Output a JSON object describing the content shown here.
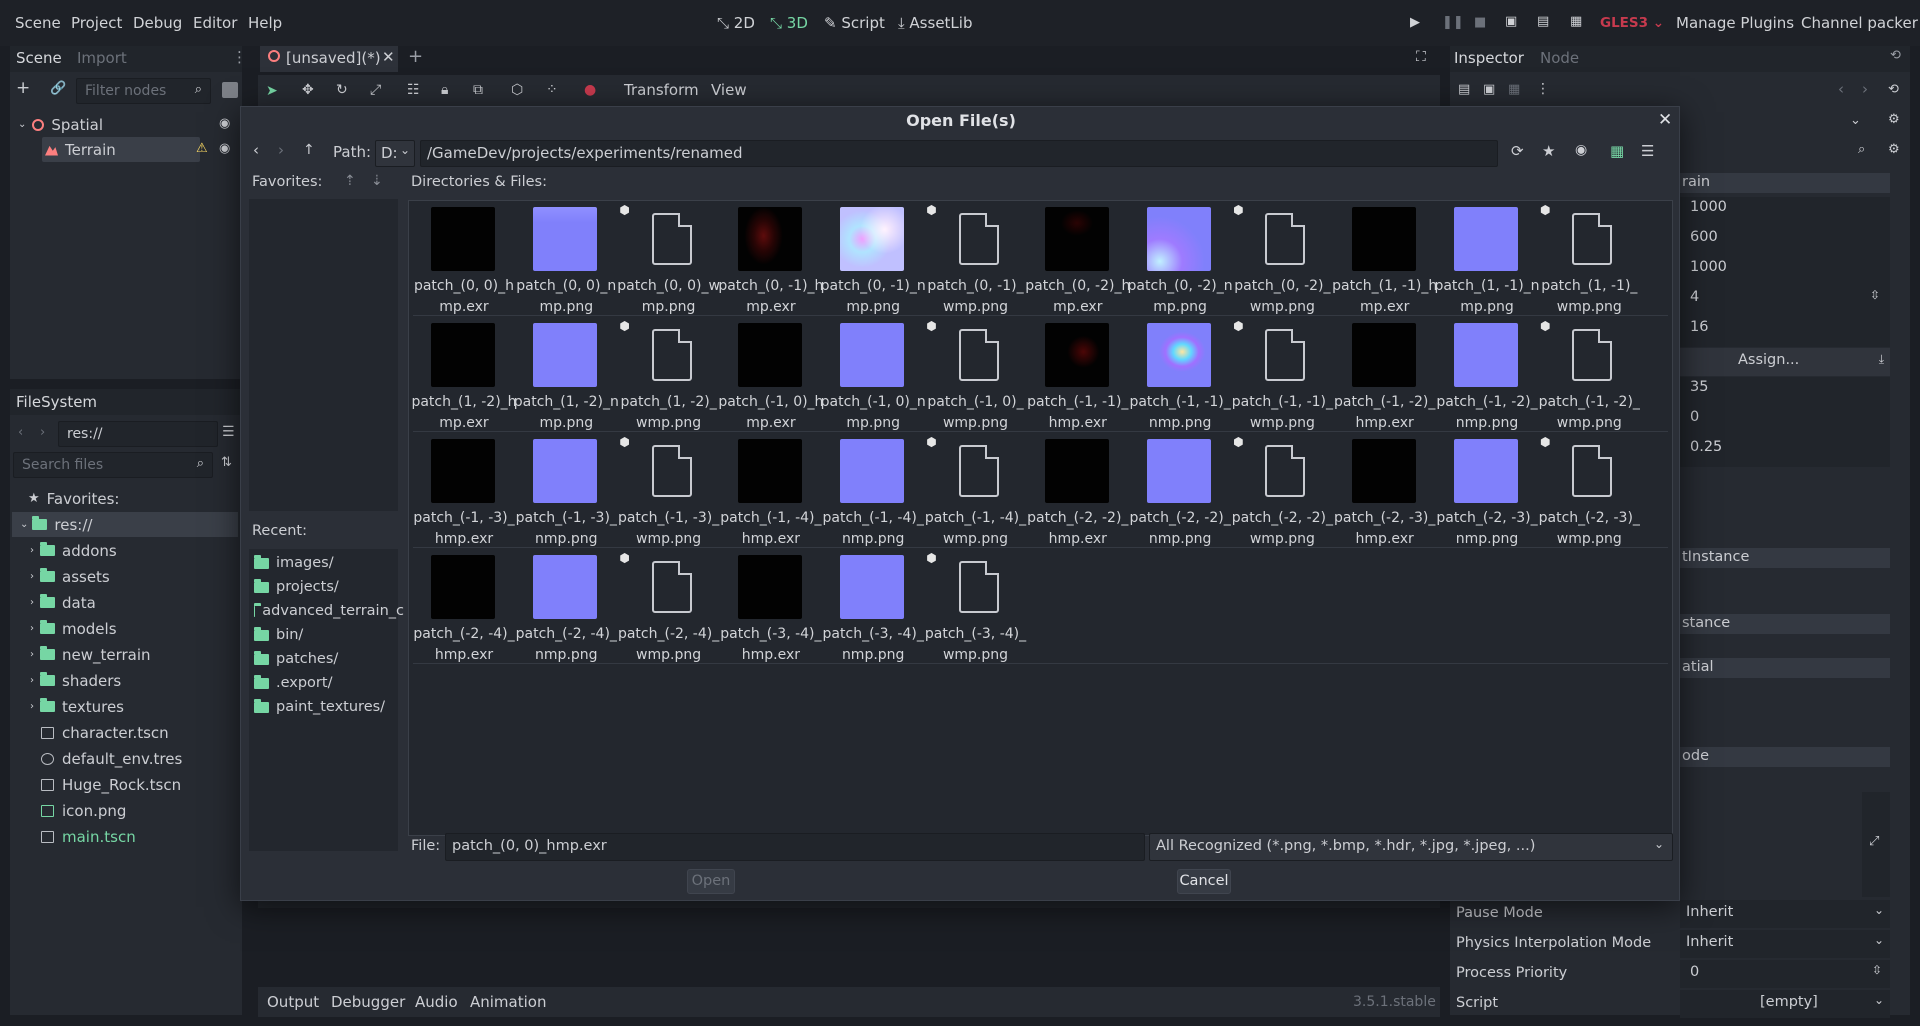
{
  "menubar": {
    "items": [
      "Scene",
      "Project",
      "Debug",
      "Editor",
      "Help"
    ],
    "workspaces": [
      "2D",
      "3D",
      "Script",
      "AssetLib"
    ],
    "renderer": "GLES3",
    "manage_plugins": "Manage Plugins",
    "channel_packer": "Channel packer"
  },
  "scene_dock": {
    "tabs": [
      "Scene",
      "Import"
    ],
    "filter_placeholder": "Filter nodes",
    "nodes": [
      {
        "name": "Spatial"
      },
      {
        "name": "Terrain"
      }
    ]
  },
  "filesystem_dock": {
    "title": "FileSystem",
    "path": "res://",
    "search_placeholder": "Search files",
    "favorites": "Favorites:",
    "root": "res://",
    "folders": [
      "addons",
      "assets",
      "data",
      "models",
      "new_terrain",
      "shaders",
      "textures"
    ],
    "files": [
      "character.tscn",
      "default_env.tres",
      "Huge_Rock.tscn",
      "icon.png",
      "main.tscn"
    ]
  },
  "editor_tab": {
    "title": "[unsaved](*)",
    "toolbar": [
      "Transform",
      "View"
    ]
  },
  "inspector": {
    "tabs": [
      "Inspector",
      "Node"
    ],
    "values": [
      "1000",
      "600",
      "1000",
      "4",
      "16",
      "Assign...",
      "35",
      "0",
      "0.25"
    ],
    "section_fragments": [
      "rain",
      "tInstance",
      "stance",
      "atial",
      "ode"
    ],
    "bottom_props": [
      {
        "label": "Pause Mode",
        "value": "Inherit"
      },
      {
        "label": "Physics Interpolation Mode",
        "value": "Inherit"
      },
      {
        "label": "Process Priority",
        "value": "0"
      },
      {
        "label": "Script",
        "value": "[empty]"
      }
    ]
  },
  "bottom_panel": {
    "tabs": [
      "Output",
      "Debugger",
      "Audio",
      "Animation"
    ],
    "version": "3.5.1.stable"
  },
  "dialog": {
    "title": "Open File(s)",
    "path_label": "Path:",
    "drive": "D:",
    "path": "/GameDev/projects/experiments/renamed",
    "favorites_label": "Favorites:",
    "dirs_label": "Directories & Files:",
    "recent_label": "Recent:",
    "recent": [
      "images/",
      "projects/",
      "advanced_terrain_c",
      "bin/",
      "patches/",
      ".export/",
      "paint_textures/"
    ],
    "file_label": "File:",
    "file_value": "patch_(0, 0)_hmp.exr",
    "filter": "All Recognized (*.png, *.bmp, *.hdr, *.jpg, *.jpeg, ...)",
    "open": "Open",
    "cancel": "Cancel",
    "files": [
      {
        "line1": "patch_(0, 0)_h",
        "line2": "mp.exr",
        "kind": "exr",
        "thumb": "exr"
      },
      {
        "line1": "patch_(0, 0)_n",
        "line2": "mp.png",
        "kind": "png",
        "thumb": "n0"
      },
      {
        "line1": "patch_(0, 0)_w",
        "line2": "mp.png",
        "kind": "doc",
        "thumb": "doc"
      },
      {
        "line1": "patch_(0, -1)_h",
        "line2": "mp.exr",
        "kind": "exr",
        "thumb": "r1"
      },
      {
        "line1": "patch_(0, -1)_n",
        "line2": "mp.png",
        "kind": "png",
        "thumb": "n1"
      },
      {
        "line1": "patch_(0, -1)_",
        "line2": "wmp.png",
        "kind": "doc",
        "thumb": "doc"
      },
      {
        "line1": "patch_(0, -2)_h",
        "line2": "mp.exr",
        "kind": "exr",
        "thumb": "r2"
      },
      {
        "line1": "patch_(0, -2)_n",
        "line2": "mp.png",
        "kind": "png",
        "thumb": "n2"
      },
      {
        "line1": "patch_(0, -2)_",
        "line2": "wmp.png",
        "kind": "doc",
        "thumb": "doc"
      },
      {
        "line1": "patch_(1, -1)_h",
        "line2": "mp.exr",
        "kind": "exr",
        "thumb": "exr"
      },
      {
        "line1": "patch_(1, -1)_n",
        "line2": "mp.png",
        "kind": "png",
        "thumb": "png"
      },
      {
        "line1": "patch_(1, -1)_",
        "line2": "wmp.png",
        "kind": "doc",
        "thumb": "doc"
      },
      {
        "line1": "patch_(1, -2)_h",
        "line2": "mp.exr",
        "kind": "exr",
        "thumb": "exr"
      },
      {
        "line1": "patch_(1, -2)_n",
        "line2": "mp.png",
        "kind": "png",
        "thumb": "png"
      },
      {
        "line1": "patch_(1, -2)_",
        "line2": "wmp.png",
        "kind": "doc",
        "thumb": "doc"
      },
      {
        "line1": "patch_(-1, 0)_h",
        "line2": "mp.exr",
        "kind": "exr",
        "thumb": "exr"
      },
      {
        "line1": "patch_(-1, 0)_n",
        "line2": "mp.png",
        "kind": "png",
        "thumb": "png"
      },
      {
        "line1": "patch_(-1, 0)_",
        "line2": "wmp.png",
        "kind": "doc",
        "thumb": "doc"
      },
      {
        "line1": "patch_(-1, -1)_",
        "line2": "hmp.exr",
        "kind": "exr",
        "thumb": "r3"
      },
      {
        "line1": "patch_(-1, -1)_",
        "line2": "nmp.png",
        "kind": "png",
        "thumb": "n3"
      },
      {
        "line1": "patch_(-1, -1)_",
        "line2": "wmp.png",
        "kind": "doc",
        "thumb": "doc"
      },
      {
        "line1": "patch_(-1, -2)_",
        "line2": "hmp.exr",
        "kind": "exr",
        "thumb": "exr"
      },
      {
        "line1": "patch_(-1, -2)_",
        "line2": "nmp.png",
        "kind": "png",
        "thumb": "png"
      },
      {
        "line1": "patch_(-1, -2)_",
        "line2": "wmp.png",
        "kind": "doc",
        "thumb": "doc"
      },
      {
        "line1": "patch_(-1, -3)_",
        "line2": "hmp.exr",
        "kind": "exr",
        "thumb": "exr"
      },
      {
        "line1": "patch_(-1, -3)_",
        "line2": "nmp.png",
        "kind": "png",
        "thumb": "png"
      },
      {
        "line1": "patch_(-1, -3)_",
        "line2": "wmp.png",
        "kind": "doc",
        "thumb": "doc"
      },
      {
        "line1": "patch_(-1, -4)_",
        "line2": "hmp.exr",
        "kind": "exr",
        "thumb": "exr"
      },
      {
        "line1": "patch_(-1, -4)_",
        "line2": "nmp.png",
        "kind": "png",
        "thumb": "png"
      },
      {
        "line1": "patch_(-1, -4)_",
        "line2": "wmp.png",
        "kind": "doc",
        "thumb": "doc"
      },
      {
        "line1": "patch_(-2, -2)_",
        "line2": "hmp.exr",
        "kind": "exr",
        "thumb": "exr"
      },
      {
        "line1": "patch_(-2, -2)_",
        "line2": "nmp.png",
        "kind": "png",
        "thumb": "png"
      },
      {
        "line1": "patch_(-2, -2)_",
        "line2": "wmp.png",
        "kind": "doc",
        "thumb": "doc"
      },
      {
        "line1": "patch_(-2, -3)_",
        "line2": "hmp.exr",
        "kind": "exr",
        "thumb": "exr"
      },
      {
        "line1": "patch_(-2, -3)_",
        "line2": "nmp.png",
        "kind": "png",
        "thumb": "png"
      },
      {
        "line1": "patch_(-2, -3)_",
        "line2": "wmp.png",
        "kind": "doc",
        "thumb": "doc"
      },
      {
        "line1": "patch_(-2, -4)_",
        "line2": "hmp.exr",
        "kind": "exr",
        "thumb": "exr"
      },
      {
        "line1": "patch_(-2, -4)_",
        "line2": "nmp.png",
        "kind": "png",
        "thumb": "png"
      },
      {
        "line1": "patch_(-2, -4)_",
        "line2": "wmp.png",
        "kind": "doc",
        "thumb": "doc"
      },
      {
        "line1": "patch_(-3, -4)_",
        "line2": "hmp.exr",
        "kind": "exr",
        "thumb": "exr"
      },
      {
        "line1": "patch_(-3, -4)_",
        "line2": "nmp.png",
        "kind": "png",
        "thumb": "png"
      },
      {
        "line1": "patch_(-3, -4)_",
        "line2": "wmp.png",
        "kind": "doc",
        "thumb": "doc"
      }
    ]
  },
  "colors": {
    "accent": "#76d6a4",
    "bg": "#1b1e24",
    "panel": "#262a31",
    "dialog": "#2b2f37",
    "renderer": "#c73a4e"
  }
}
